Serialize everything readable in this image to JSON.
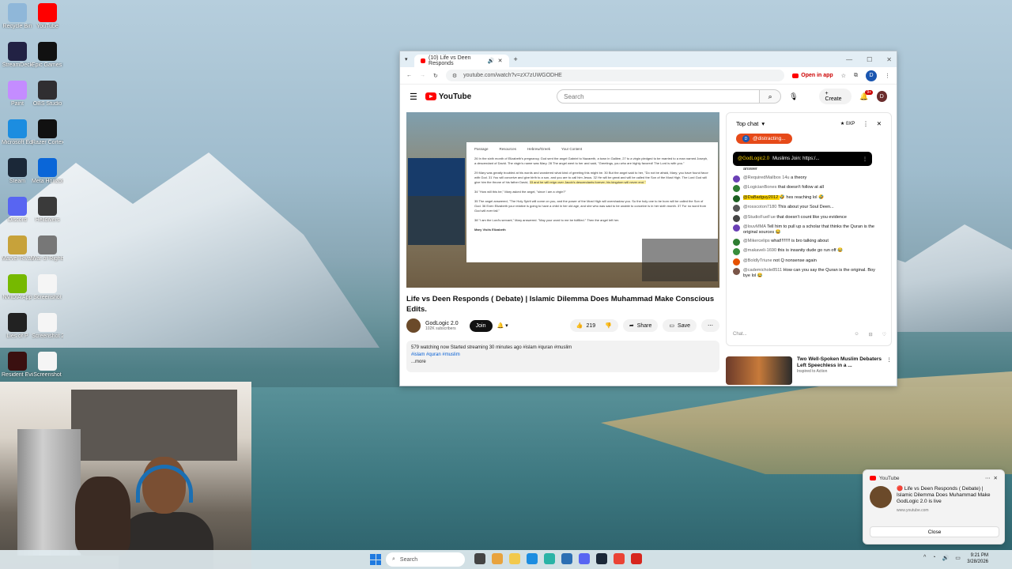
{
  "desktop": {
    "icons": [
      {
        "label": "Recycle Bin",
        "color": "#8fb7d9"
      },
      {
        "label": "YouTube",
        "color": "#ff0000"
      },
      {
        "label": "StreamDeck",
        "color": "#222244"
      },
      {
        "label": "Epic Games Launcher",
        "color": "#111111"
      },
      {
        "label": "Paint",
        "color": "#c48cff"
      },
      {
        "label": "OBS Studio",
        "color": "#302e31"
      },
      {
        "label": "Microsoft Edge",
        "color": "#1c8de0"
      },
      {
        "label": "Razer Cortex",
        "color": "#111111"
      },
      {
        "label": "Steam",
        "color": "#1b2838"
      },
      {
        "label": "Meta Horizon Link",
        "color": "#0a66d8"
      },
      {
        "label": "Discord",
        "color": "#5865f2"
      },
      {
        "label": "Helldivers",
        "color": "#3a3a3a"
      },
      {
        "label": "Marvel Rivals",
        "color": "#c7a23a"
      },
      {
        "label": "War of Rights",
        "color": "#777777"
      },
      {
        "label": "NVIDIA App",
        "color": "#76b900"
      },
      {
        "label": "Screenshot",
        "color": "#f5f5f5"
      },
      {
        "label": "Lies of P",
        "color": "#222222"
      },
      {
        "label": "Screenshot 2025-0...",
        "color": "#f5f5f5"
      },
      {
        "label": "Resident Evil",
        "color": "#3a1010"
      },
      {
        "label": "Screenshot",
        "color": "#f5f5f5"
      }
    ]
  },
  "browser": {
    "tab_title": "(10) Life vs Deen Responds",
    "url": "youtube.com/watch?v=zX7zUWGODHE",
    "open_in_app": "Open in app",
    "profile_initial": "D"
  },
  "youtube": {
    "logo_text": "YouTube",
    "search_placeholder": "Search",
    "create_label": "Create",
    "notif_count": "9+",
    "avatar_initial": "D",
    "video": {
      "title": "Life vs Deen Responds ( Debate) | Islamic Dilemma Does Muhammad Make Conscious Edits.",
      "channel": "GodLogic 2.0",
      "subscribers": "102K subscribers",
      "join_label": "Join",
      "likes": "219",
      "share_label": "Share",
      "save_label": "Save",
      "watching": "579 watching now  Started streaming 30 minutes ago  #islam #quran #muslim",
      "tags": "#islam #quran #muslim",
      "more": "...more",
      "bible_nav": [
        "Passage",
        "Resources",
        "Hebrew/Greek",
        "Your Content"
      ],
      "bible_text_1": "26 In the sixth month of Elizabeth's pregnancy, God sent the angel Gabriel to Nazareth, a town in Galilee, 27 to a virgin pledged to be married to a man named Joseph, a descendant of David. The virgin's name was Mary. 28 The angel went to her and said, \"Greetings, you who are highly favored! The Lord is with you.\"",
      "bible_text_2": "29 Mary was greatly troubled at his words and wondered what kind of greeting this might be. 30 But the angel said to her, \"Do not be afraid, Mary; you have found favor with God. 31 You will conceive and give birth to a son, and you are to call him Jesus. 32 He will be great and will be called the Son of the Most High. The Lord God will give him the throne of his father David,",
      "bible_text_hl": "33 and he will reign over Jacob's descendants forever; his kingdom will never end.\"",
      "bible_text_3": "34 \"How will this be,\" Mary asked the angel, \"since I am a virgin?\"",
      "bible_text_4": "35 The angel answered, \"The Holy Spirit will come on you, and the power of the Most High will overshadow you. So the holy one to be born will be called the Son of God. 36 Even Elizabeth your relative is going to have a child in her old age, and she who was said to be unable to conceive is in her sixth month. 37 For no word from God will ever fail.\"",
      "bible_text_5": "38 \"I am the Lord's servant,\" Mary answered. \"May your word to me be fulfilled.\" Then the angel left her.",
      "bible_heading": "Mary Visits Elizabeth"
    },
    "chat": {
      "header": "Top chat",
      "points": "0XP",
      "pinned_user": "@distracting...",
      "pinned_name": "@GodLogic2.0",
      "pinned_text": "Muslims Join: https:/...",
      "partial_top": "answer",
      "messages": [
        {
          "name": "@RequiredMailbox 14u",
          "text": "a theory",
          "color": "#6a3fb5"
        },
        {
          "name": "@LogicianBones",
          "text": "that doesn't follow at all",
          "color": "#2e7d32"
        },
        {
          "name": "@DaBadguy2012",
          "text": "🤣 hes reaching lol 🤣",
          "color": "#1b5e20",
          "highlight": true
        },
        {
          "name": "@rosscoton7180",
          "text": "This about your Soul Deen...",
          "color": "#555555"
        },
        {
          "name": "@StudioFueFue",
          "text": "that doesn't count like you evidence",
          "color": "#444444"
        },
        {
          "name": "@louvMMA",
          "text": "Tell him to pull up a scholar that thinks the Quran is the original sources 😂",
          "color": "#6a3fb5"
        },
        {
          "name": "@Mikercelips",
          "text": "what!!!!!!!! is bro talking about",
          "color": "#2e7d32"
        },
        {
          "name": "@makaveli-1690",
          "text": "this is insanity dude go run off 😂",
          "color": "#388e3c"
        },
        {
          "name": "@BoldlyTriune",
          "text": "not Q nonsense again",
          "color": "#e65100"
        },
        {
          "name": "@cademichole8511",
          "text": "How can you say the Quran is the original. Boy bye lol 😂",
          "color": "#795548"
        }
      ],
      "input_placeholder": "Chat..."
    },
    "recommendation": {
      "title": "Two Well-Spoken Muslim Debaters Left Speechless in a ...",
      "channel": "Inspired to Action"
    }
  },
  "notification": {
    "app": "YouTube",
    "message": "🔴 Life vs Deen Responds ( Debate) | Islamic Dilemma Does Muhammad Make GodLogic 2.0 is live",
    "site": "www.youtube.com",
    "close_label": "Close"
  },
  "taskbar": {
    "search_label": "Search",
    "time": "9:21 PM",
    "date": "3/28/2026"
  }
}
